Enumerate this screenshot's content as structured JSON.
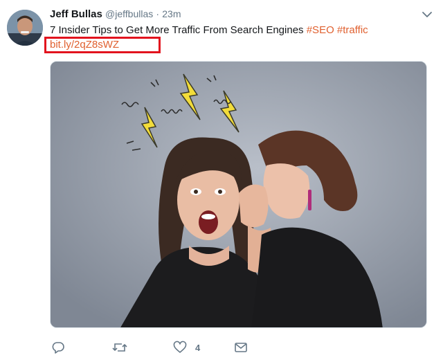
{
  "tweet": {
    "author": {
      "display_name": "Jeff Bullas",
      "handle": "@jeffbullas",
      "separator": "·",
      "timestamp": "23m"
    },
    "text": "7 Insider Tips to Get More Traffic From Search Engines",
    "hashtags": [
      "#SEO",
      "#traffic"
    ],
    "link": "bit.ly/2qZ8sWZ",
    "media_description_icon": "photo",
    "actions": {
      "reply_icon": "reply-icon",
      "retweet_icon": "retweet-icon",
      "like_icon": "heart-icon",
      "like_count": "4",
      "message_icon": "envelope-icon"
    }
  },
  "colors": {
    "hashtag": "#e0602f",
    "highlight_box": "#e2131e",
    "meta_text": "#657786",
    "text": "#14171a"
  }
}
